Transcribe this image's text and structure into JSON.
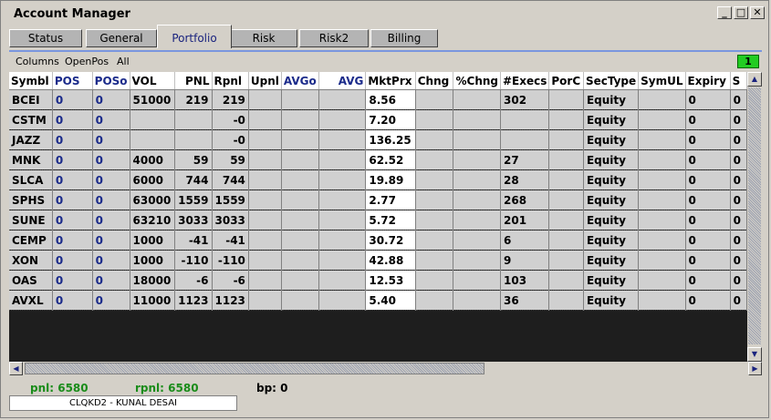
{
  "window": {
    "title": "Account Manager",
    "controls": [
      "minimize-icon",
      "maximize-icon",
      "close-icon"
    ]
  },
  "tabs": [
    {
      "label": "Status",
      "active": false
    },
    {
      "label": "General",
      "active": false
    },
    {
      "label": "Portfolio",
      "active": true
    },
    {
      "label": "Risk",
      "active": false
    },
    {
      "label": "Risk2",
      "active": false
    },
    {
      "label": "Billing",
      "active": false
    }
  ],
  "menu": {
    "columns": "Columns",
    "openpos": "OpenPos",
    "all": "All",
    "indicator": "1"
  },
  "table": {
    "headers": [
      "Symbl",
      "POS",
      "POSo",
      "VOL",
      "PNL",
      "Rpnl",
      "Upnl",
      "AVGo",
      "AVG",
      "MktPrx",
      "Chng",
      "%Chng",
      "#Execs",
      "PorC",
      "SecType",
      "SymUL",
      "Expiry",
      "S"
    ],
    "rows": [
      [
        "BCEI",
        "0",
        "0",
        "51000",
        "219",
        "219",
        "",
        "",
        "",
        "8.56",
        "",
        "",
        "302",
        "",
        "Equity",
        "",
        "0",
        "0"
      ],
      [
        "CSTM",
        "0",
        "0",
        "",
        "",
        "-0",
        "",
        "",
        "",
        "7.20",
        "",
        "",
        "",
        "",
        "Equity",
        "",
        "0",
        "0"
      ],
      [
        "JAZZ",
        "0",
        "0",
        "",
        "",
        "-0",
        "",
        "",
        "",
        "136.25",
        "",
        "",
        "",
        "",
        "Equity",
        "",
        "0",
        "0"
      ],
      [
        "MNK",
        "0",
        "0",
        "4000",
        "59",
        "59",
        "",
        "",
        "",
        "62.52",
        "",
        "",
        "27",
        "",
        "Equity",
        "",
        "0",
        "0"
      ],
      [
        "SLCA",
        "0",
        "0",
        "6000",
        "744",
        "744",
        "",
        "",
        "",
        "19.89",
        "",
        "",
        "28",
        "",
        "Equity",
        "",
        "0",
        "0"
      ],
      [
        "SPHS",
        "0",
        "0",
        "63000",
        "1559",
        "1559",
        "",
        "",
        "",
        "2.77",
        "",
        "",
        "268",
        "",
        "Equity",
        "",
        "0",
        "0"
      ],
      [
        "SUNE",
        "0",
        "0",
        "63210",
        "3033",
        "3033",
        "",
        "",
        "",
        "5.72",
        "",
        "",
        "201",
        "",
        "Equity",
        "",
        "0",
        "0"
      ],
      [
        "CEMP",
        "0",
        "0",
        "1000",
        "-41",
        "-41",
        "",
        "",
        "",
        "30.72",
        "",
        "",
        "6",
        "",
        "Equity",
        "",
        "0",
        "0"
      ],
      [
        "XON",
        "0",
        "0",
        "1000",
        "-110",
        "-110",
        "",
        "",
        "",
        "42.88",
        "",
        "",
        "9",
        "",
        "Equity",
        "",
        "0",
        "0"
      ],
      [
        "OAS",
        "0",
        "0",
        "18000",
        "-6",
        "-6",
        "",
        "",
        "",
        "12.53",
        "",
        "",
        "103",
        "",
        "Equity",
        "",
        "0",
        "0"
      ],
      [
        "AVXL",
        "0",
        "0",
        "11000",
        "1123",
        "1123",
        "",
        "",
        "",
        "5.40",
        "",
        "",
        "36",
        "",
        "Equity",
        "",
        "0",
        "0"
      ]
    ]
  },
  "status": {
    "pnl": "pnl: 6580",
    "rpnl": "rpnl: 6580",
    "bp": "bp: 0",
    "user": "CLQKD2 - KUNAL DESAI"
  },
  "colors": {
    "accent_blue": "#1a2a8a",
    "positive_green": "#1a8c1a",
    "indicator_green": "#22cc22"
  }
}
